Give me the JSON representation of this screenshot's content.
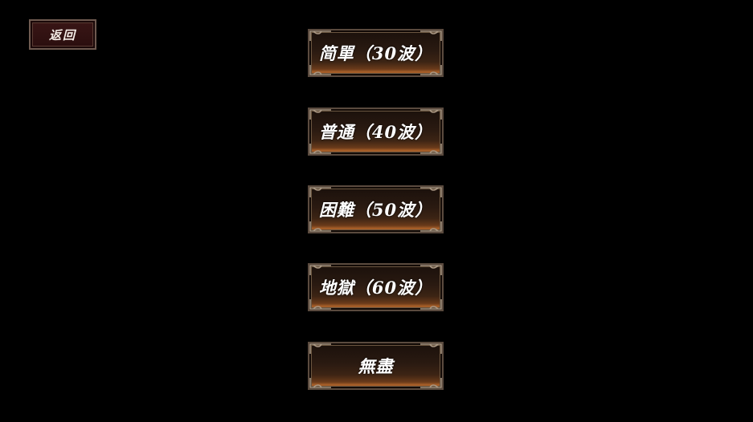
{
  "back_button": {
    "label": "返回"
  },
  "difficulty_options": [
    {
      "label": "简單（30波）"
    },
    {
      "label": "普通（40波）"
    },
    {
      "label": "困難（50波）"
    },
    {
      "label": "地獄（60波）"
    },
    {
      "label": "無盡"
    }
  ],
  "colors": {
    "background": "#000000",
    "button_text": "#ffffff",
    "button_frame": "#a89682",
    "button_glow": "#b0642a",
    "back_button_fill": "#3a1616"
  }
}
